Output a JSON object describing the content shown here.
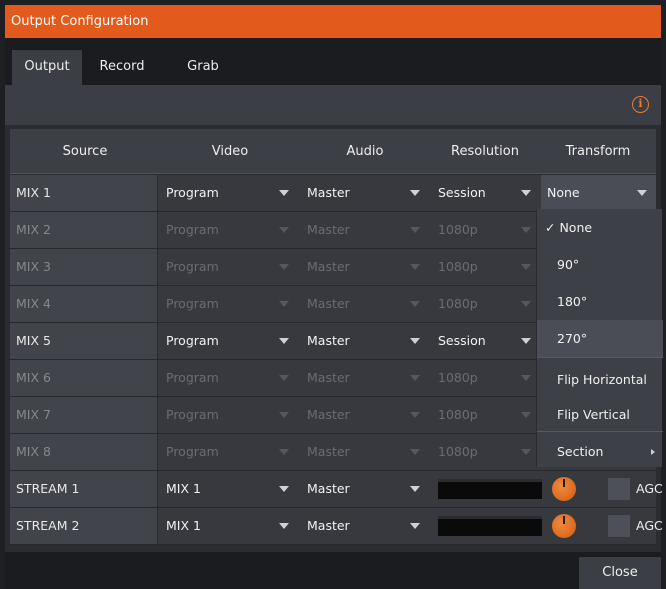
{
  "window": {
    "title": "Output Configuration"
  },
  "tabs": [
    {
      "label": "Output",
      "active": true
    },
    {
      "label": "Record",
      "active": false
    },
    {
      "label": "Grab",
      "active": false
    }
  ],
  "columns": [
    "Source",
    "Video",
    "Audio",
    "Resolution",
    "Transform"
  ],
  "rows": [
    {
      "source": "MIX 1",
      "video": "Program",
      "audio": "Master",
      "resolution": "Session",
      "transform": "None",
      "enabled": true
    },
    {
      "source": "MIX 2",
      "video": "Program",
      "audio": "Master",
      "resolution": "1080p",
      "enabled": false
    },
    {
      "source": "MIX 3",
      "video": "Program",
      "audio": "Master",
      "resolution": "1080p",
      "enabled": false
    },
    {
      "source": "MIX 4",
      "video": "Program",
      "audio": "Master",
      "resolution": "1080p",
      "enabled": false
    },
    {
      "source": "MIX 5",
      "video": "Program",
      "audio": "Master",
      "resolution": "Session",
      "enabled": true
    },
    {
      "source": "MIX 6",
      "video": "Program",
      "audio": "Master",
      "resolution": "1080p",
      "enabled": false
    },
    {
      "source": "MIX 7",
      "video": "Program",
      "audio": "Master",
      "resolution": "1080p",
      "enabled": false
    },
    {
      "source": "MIX 8",
      "video": "Program",
      "audio": "Master",
      "resolution": "1080p",
      "enabled": false
    }
  ],
  "streams": [
    {
      "source": "STREAM 1",
      "video": "MIX 1",
      "audio": "Master",
      "agc_label": "AGC"
    },
    {
      "source": "STREAM 2",
      "video": "MIX 1",
      "audio": "Master",
      "agc_label": "AGC"
    }
  ],
  "transform_menu": {
    "items": [
      "✓ None",
      "90°",
      "180°",
      "270°",
      "Flip Horizontal",
      "Flip Vertical",
      "Section"
    ],
    "selected": "None",
    "highlighted": "270°"
  },
  "icons": {
    "info": "info-icon",
    "dropdown": "chevron-down-icon",
    "submenu": "chevron-right-icon"
  },
  "colors": {
    "accent": "#e35a1d",
    "knob": "#e8742a"
  },
  "footer": {
    "close_label": "Close"
  }
}
